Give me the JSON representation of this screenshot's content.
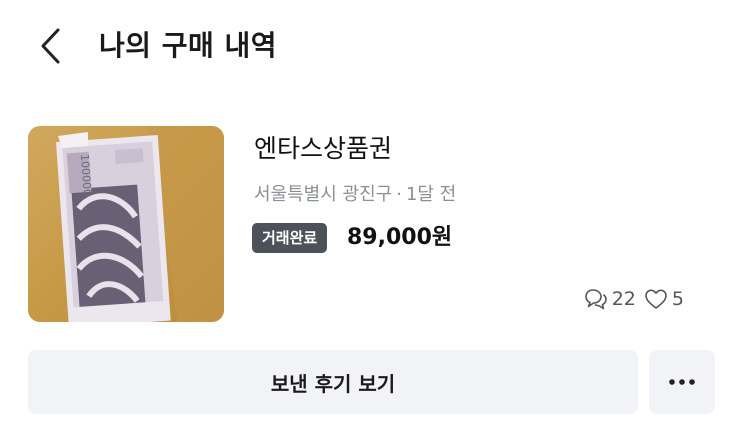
{
  "header": {
    "back_icon": "chevron-left-icon",
    "title": "나의 구매 내역"
  },
  "purchase": {
    "title": "엔타스상품권",
    "location": "서울특별시 광진구",
    "separator": "·",
    "time": "1달 전",
    "status": "거래완료",
    "price": "89,000원",
    "chat_icon": "chat-bubble-icon",
    "chat_count": "22",
    "like_icon": "heart-icon",
    "like_count": "5"
  },
  "actions": {
    "review_label": "보낸 후기 보기",
    "more_icon": "more-horizontal-icon"
  },
  "colors": {
    "badge_bg": "#4d5159",
    "button_bg": "#f2f3f6",
    "meta_text": "#8a8f98"
  }
}
